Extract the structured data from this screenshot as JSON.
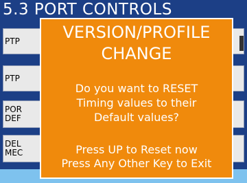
{
  "screen": {
    "title": "5.3 PORT CONTROLS"
  },
  "menu": {
    "items": [
      {
        "label": "PTP"
      },
      {
        "label": "PTP"
      },
      {
        "label": "POR\nDEF"
      },
      {
        "label": "DEL\nMEC"
      }
    ]
  },
  "dialog": {
    "title": "VERSION/PROFILE\nCHANGE",
    "message": "Do you want to RESET\nTiming values to their\nDefault values?",
    "instruction_reset": "Press UP to Reset now",
    "instruction_exit": "Press Any Other Key to Exit"
  },
  "colors": {
    "screen_bg": "#1c3f86",
    "dialog_bg": "#f08a0c",
    "dialog_border": "#ffffff",
    "menu_bg": "#e9e9e9",
    "bottom_band": "#7ec2ee"
  }
}
